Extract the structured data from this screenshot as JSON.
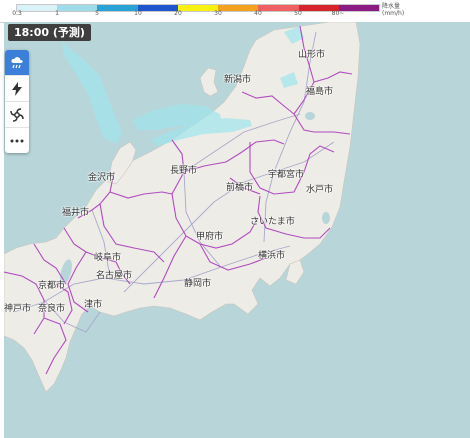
{
  "legend": {
    "ticks": [
      "0.3",
      "1",
      "5",
      "10",
      "20",
      "30",
      "40",
      "50",
      "80~"
    ],
    "unit_line1": "降水量",
    "unit_line2": "(mm/h)",
    "colors": [
      "#d9f2f7",
      "#9fdbe8",
      "#29a3d6",
      "#1f55cc",
      "#f7f213",
      "#f2a21f",
      "#ef6060",
      "#d6242c",
      "#8b1a82"
    ]
  },
  "time_label": "18:00 (予測)",
  "toolbar": {
    "active_color": "#3b7fd9",
    "buttons": [
      "rain-icon",
      "lightning-icon",
      "typhoon-icon",
      "more-icon"
    ]
  },
  "map": {
    "sea_color": "#b8d5d9",
    "land_color": "#eeece6",
    "border_color": "#b04cbf",
    "precip_color": "#9fe6ec"
  },
  "cities": [
    {
      "id": "yamagata",
      "label": "山形市"
    },
    {
      "id": "niigata",
      "label": "新潟市"
    },
    {
      "id": "fukushima",
      "label": "福島市"
    },
    {
      "id": "kanazawa",
      "label": "金沢市"
    },
    {
      "id": "nagano",
      "label": "長野市"
    },
    {
      "id": "utsunomiya",
      "label": "宇都宮市"
    },
    {
      "id": "maebashi",
      "label": "前橋市"
    },
    {
      "id": "mito",
      "label": "水戸市"
    },
    {
      "id": "fukui",
      "label": "福井市"
    },
    {
      "id": "saitama",
      "label": "さいたま市"
    },
    {
      "id": "kofu",
      "label": "甲府市"
    },
    {
      "id": "gifu",
      "label": "岐阜市"
    },
    {
      "id": "yokohama",
      "label": "横浜市"
    },
    {
      "id": "nagoya",
      "label": "名古屋市"
    },
    {
      "id": "kyoto",
      "label": "京都市"
    },
    {
      "id": "shizuoka",
      "label": "静岡市"
    },
    {
      "id": "tsu",
      "label": "津市"
    },
    {
      "id": "kobe",
      "label": "神戸市"
    },
    {
      "id": "nara",
      "label": "奈良市"
    }
  ]
}
